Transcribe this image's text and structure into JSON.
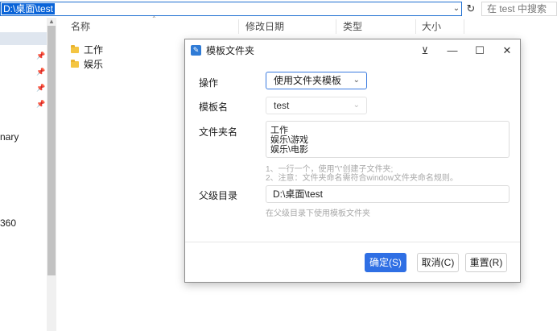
{
  "address_bar": {
    "path": "D:\\桌面\\test",
    "search_placeholder": "在 test 中搜索"
  },
  "nav_pane": {
    "items": [
      "nary",
      "360"
    ]
  },
  "columns": {
    "name": "名称",
    "modified": "修改日期",
    "type": "类型",
    "size": "大小"
  },
  "files": [
    {
      "name": "工作"
    },
    {
      "name": "娱乐"
    }
  ],
  "dialog": {
    "title": "模板文件夹",
    "operation": {
      "label": "操作",
      "value": "使用文件夹模板"
    },
    "template": {
      "label": "模板名",
      "value": "test"
    },
    "folder_names": {
      "label": "文件夹名",
      "lines": [
        "工作",
        "娱乐\\游戏",
        "娱乐\\电影"
      ]
    },
    "hints": [
      "1、一行一个，使用\"\\\"创建子文件夹;",
      "2、注意：文件夹命名需符合window文件夹命名规则。"
    ],
    "parent_dir": {
      "label": "父级目录",
      "value": "D:\\桌面\\test",
      "hint": "在父级目录下使用模板文件夹"
    },
    "buttons": {
      "ok": "确定(S)",
      "cancel": "取消(C)",
      "reset": "重置(R)"
    }
  },
  "colors": {
    "accent": "#2f6fe4",
    "selection": "#0a64d8"
  }
}
